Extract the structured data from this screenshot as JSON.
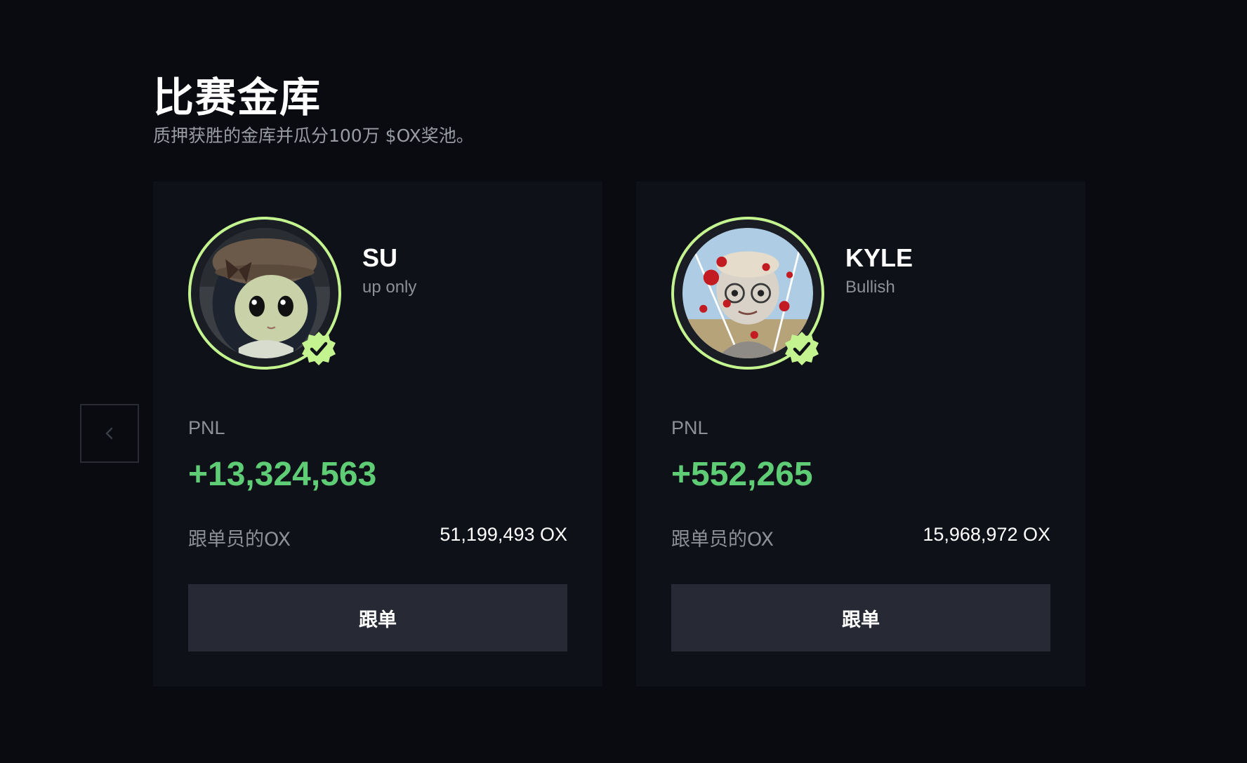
{
  "header": {
    "title": "比赛金库",
    "subtitle": "质押获胜的金库并瓜分100万 $OX奖池。"
  },
  "navigation": {
    "prev_icon": "chevron-left-icon"
  },
  "vaults": [
    {
      "name": "SU",
      "tagline": "up only",
      "pnl_label": "PNL",
      "pnl_value": "+13,324,563",
      "ox_label": "跟单员的OX",
      "ox_value": "51,199,493 OX",
      "button_label": "跟单",
      "avatar_icon": "anime-girl-avatar",
      "verified_icon": "verified-check-icon"
    },
    {
      "name": "KYLE",
      "tagline": "Bullish",
      "pnl_label": "PNL",
      "pnl_value": "+552,265",
      "ox_label": "跟单员的OX",
      "ox_value": "15,968,972 OX",
      "button_label": "跟单",
      "avatar_icon": "cartoon-boy-avatar",
      "verified_icon": "verified-check-icon"
    }
  ],
  "colors": {
    "background": "#0a0b10",
    "card": "#0f1118",
    "accent_ring": "#c4f48f",
    "pnl_positive": "#5fcd75",
    "button_bg": "#272a35",
    "muted_text": "#8e9098"
  }
}
